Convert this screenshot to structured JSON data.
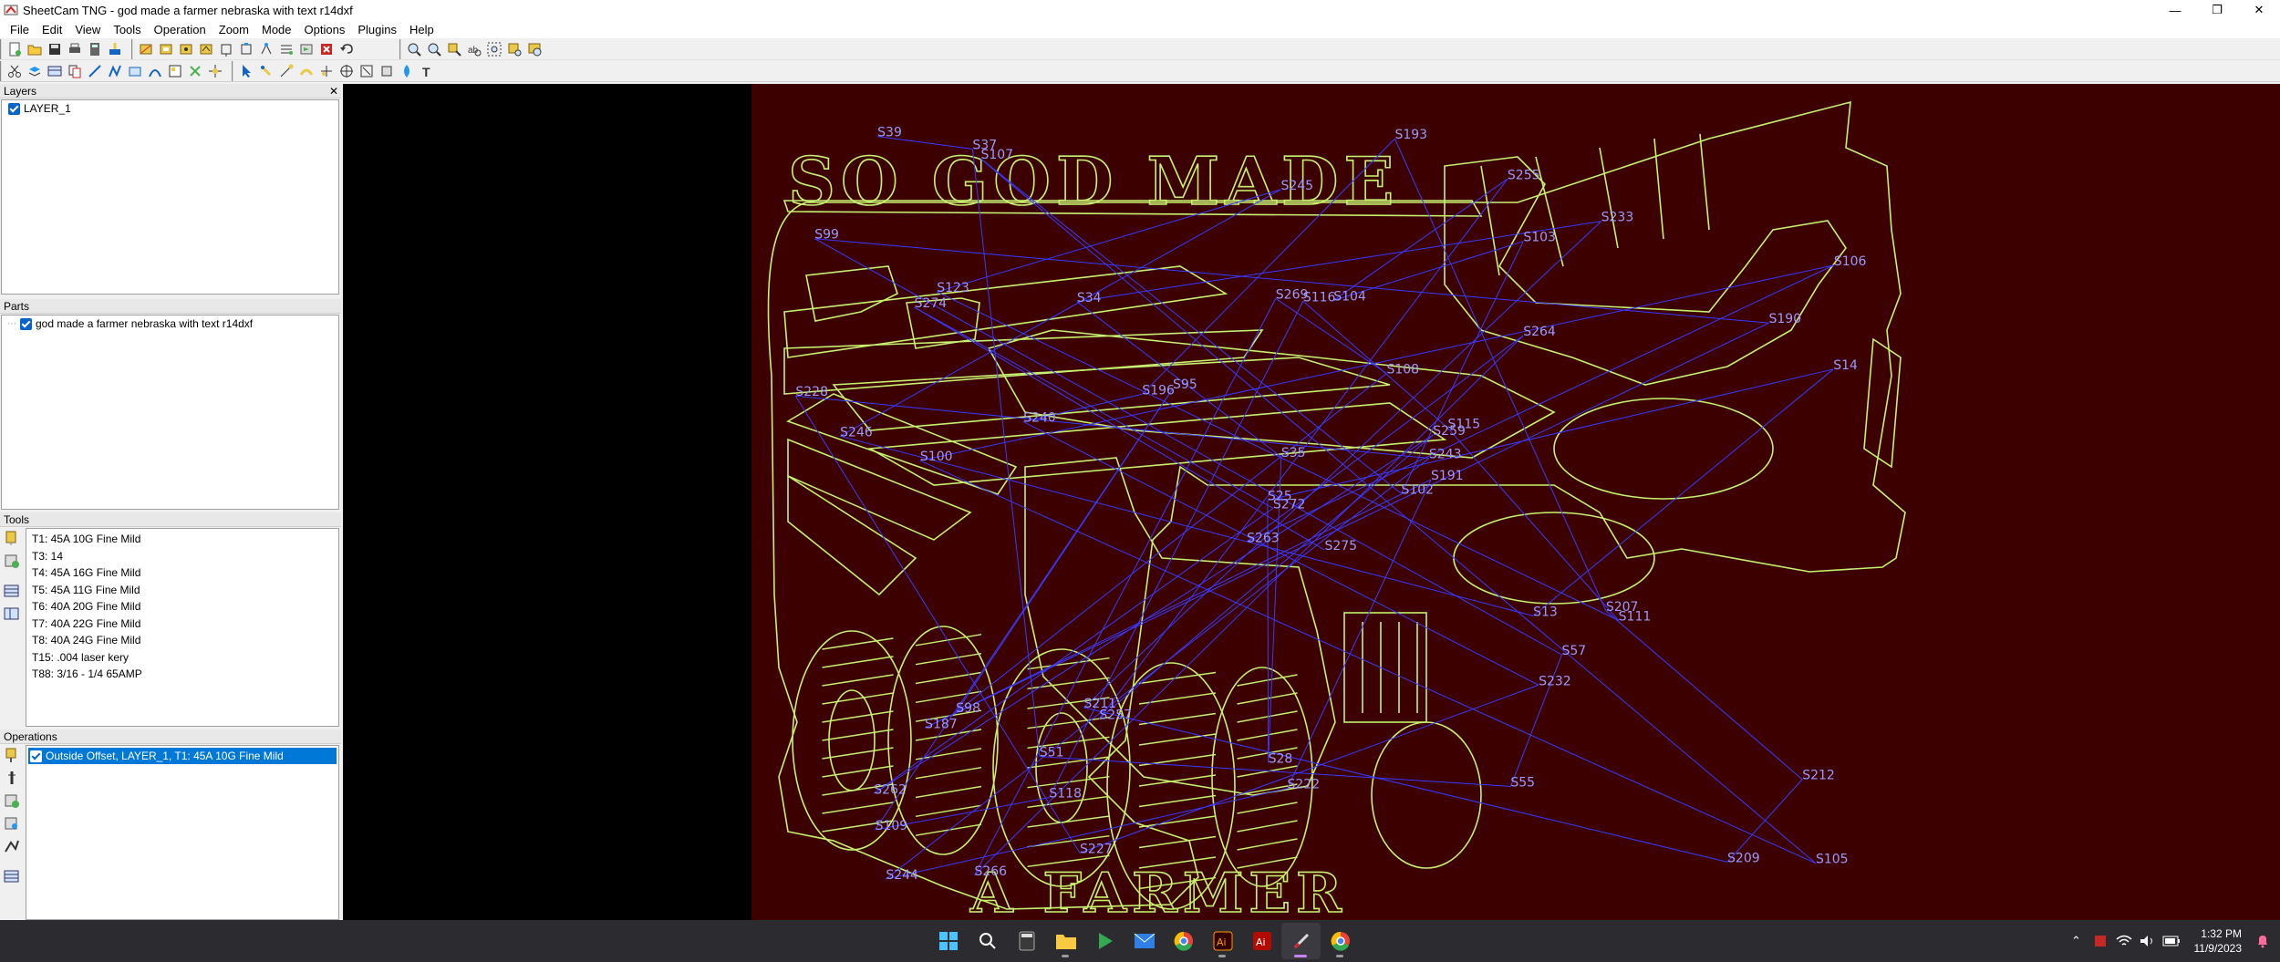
{
  "window": {
    "title": "SheetCam TNG - god made a farmer nebraska with text r14dxf",
    "controls": {
      "minimize": "—",
      "maximize": "❐",
      "close": "✕"
    }
  },
  "menu": [
    "File",
    "Edit",
    "View",
    "Tools",
    "Operation",
    "Zoom",
    "Mode",
    "Options",
    "Plugins",
    "Help"
  ],
  "panels": {
    "layers": {
      "title": "Layers",
      "close": "✕",
      "items": [
        {
          "label": "LAYER_1",
          "checked": true
        }
      ]
    },
    "parts": {
      "title": "Parts",
      "items": [
        {
          "label": "god made a farmer nebraska with text r14dxf",
          "checked": true
        }
      ]
    },
    "tools": {
      "title": "Tools",
      "items": [
        "T1: 45A 10G Fine Mild",
        "T3: 14",
        "T4: 45A 16G Fine Mild",
        "T5: 45A 11G Fine Mild",
        "T6: 40A 20G Fine Mild",
        "T7: 40A 22G Fine Mild",
        "T8: 40A 24G Fine Mild",
        "T15: .004 laser kery",
        "T88: 3/16 - 1/4 65AMP"
      ]
    },
    "operations": {
      "title": "Operations",
      "items": [
        {
          "label": "Outside Offset, LAYER_1, T1: 45A 10G Fine Mild",
          "checked": true,
          "selected": true
        }
      ]
    }
  },
  "canvas": {
    "sheet_color": "#3c0000",
    "outline_color": "#c8f070",
    "path_color": "#3a3aff",
    "label_color": "#9a9aff",
    "text_top": "SO GOD MADE",
    "text_bottom": "A FARMER",
    "labels": [
      "S275",
      "S274",
      "S272",
      "S262",
      "S259",
      "S257",
      "S255",
      "S104",
      "S103",
      "S102",
      "S107",
      "S105",
      "S100",
      "S106",
      "S263",
      "S264",
      "S266",
      "S269",
      "S108",
      "S98",
      "S95",
      "S109",
      "S118",
      "S116",
      "S115",
      "S111",
      "S123",
      "S245",
      "S246",
      "S13",
      "S14",
      "S25",
      "S28",
      "S35",
      "S34",
      "S233",
      "S211",
      "S209",
      "S212",
      "S207",
      "S193",
      "S196",
      "S240",
      "S232",
      "S227",
      "S228",
      "S243",
      "S244",
      "S222",
      "S191",
      "S187",
      "S190",
      "S99",
      "S57",
      "S55",
      "S51",
      "S37",
      "S39"
    ]
  },
  "taskbar": {
    "time": "1:32 PM",
    "date": "11/9/2023",
    "apps": [
      "windows-start",
      "search",
      "calculator",
      "file-explorer",
      "media-player",
      "mail",
      "chrome",
      "illustrator",
      "adobe",
      "sheetcam",
      "chrome-2"
    ]
  }
}
